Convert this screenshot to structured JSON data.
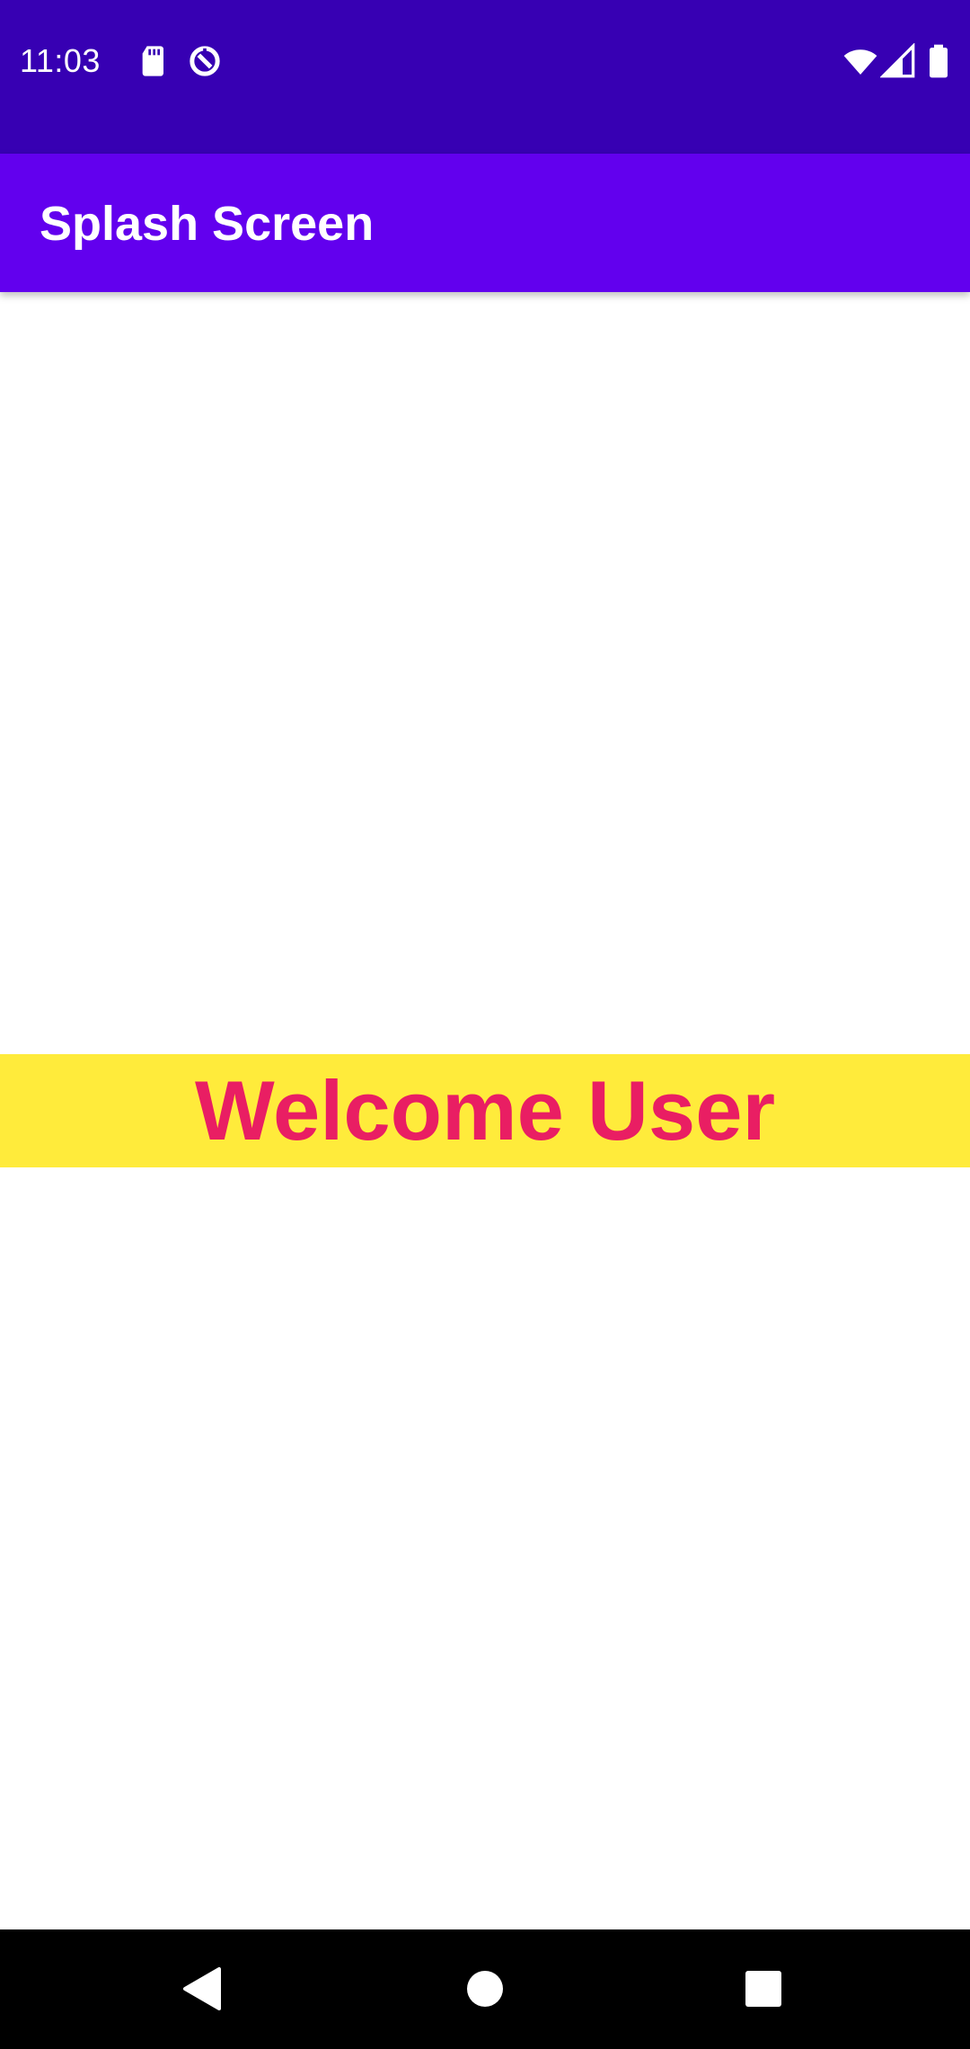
{
  "status_bar": {
    "time": "11:03",
    "background_color": "#3700b3",
    "left_icons": [
      "sd-card-icon",
      "data-saver-icon"
    ],
    "right_icons": [
      "wifi-icon",
      "cellular-signal-icon",
      "battery-icon"
    ]
  },
  "app_bar": {
    "title": "Splash Screen",
    "background_color": "#6200ee"
  },
  "main": {
    "welcome_text": "Welcome User",
    "banner_color": "#ffeb3b",
    "text_color": "#e91e63"
  },
  "nav_bar": {
    "buttons": [
      "back-icon",
      "home-icon",
      "recents-icon"
    ]
  }
}
